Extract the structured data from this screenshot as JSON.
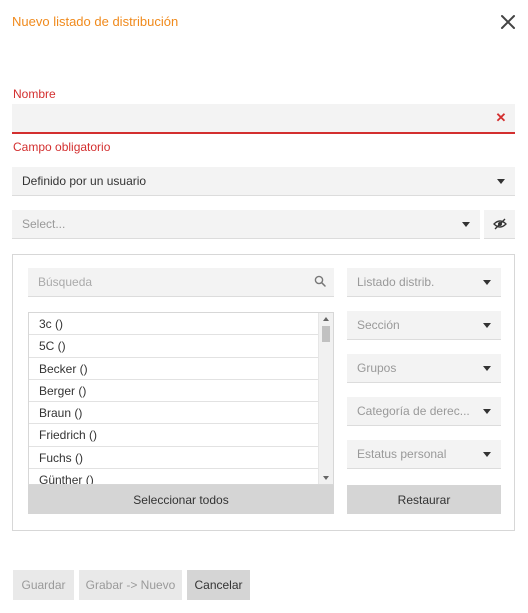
{
  "dialog": {
    "title": "Nuevo listado de distribución",
    "close_icon": "close-icon"
  },
  "name_field": {
    "label": "Nombre",
    "value": "",
    "placeholder": "",
    "clear_icon": "clear-x-icon",
    "error": "Campo obligatorio"
  },
  "type_select": {
    "value": "Definido por un usuario"
  },
  "pick_select": {
    "placeholder": "Select...",
    "toggle_icon": "eye-slash-icon"
  },
  "panel": {
    "search": {
      "placeholder": "Búsqueda",
      "icon": "search-icon"
    },
    "items": [
      "3c ()",
      "5C ()",
      "Becker ()",
      "Berger ()",
      "Braun ()",
      "Friedrich ()",
      "Fuchs ()",
      "Günther ()"
    ],
    "select_all_label": "Seleccionar todos",
    "restore_label": "Restaurar",
    "filters": [
      "Listado distrib.",
      "Sección",
      "Grupos",
      "Categoría de derec...",
      "Estatus personal"
    ]
  },
  "footer": {
    "save_label": "Guardar",
    "save_new_label": "Grabar -> Nuevo",
    "cancel_label": "Cancelar"
  },
  "colors": {
    "accent": "#f08a1c",
    "error": "#d32f2f",
    "field_bg": "#f3f3f3",
    "button_bg": "#d5d5d5"
  }
}
